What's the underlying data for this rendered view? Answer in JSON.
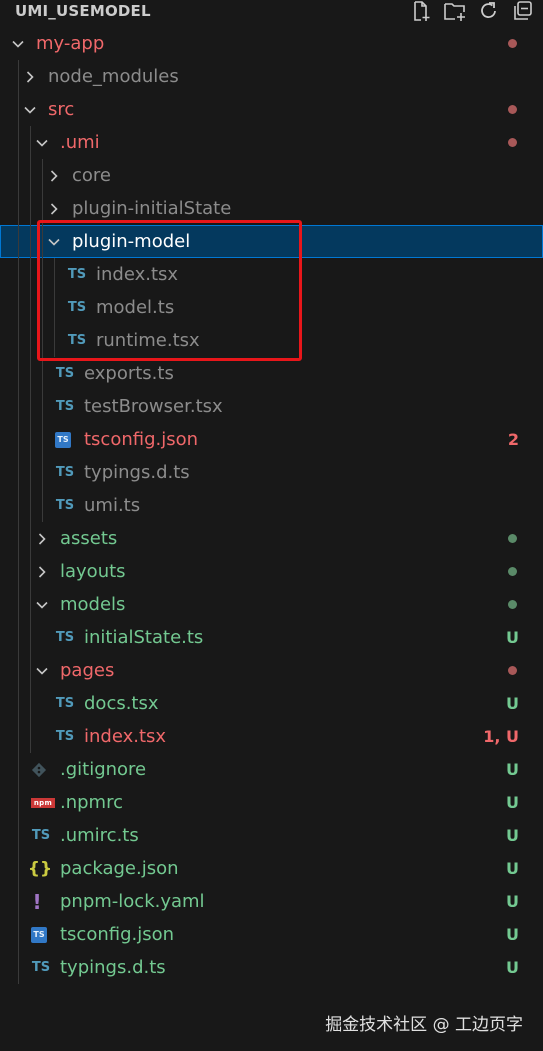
{
  "explorer": {
    "title": "UMI_USEMODEL",
    "actions": [
      {
        "name": "new-file-icon"
      },
      {
        "name": "new-folder-icon"
      },
      {
        "name": "refresh-icon"
      },
      {
        "name": "collapse-all-icon"
      }
    ]
  },
  "tree": [
    {
      "label": "my-app",
      "kind": "folder",
      "expanded": true,
      "depth": 0,
      "color": "red",
      "badge": "dot-red"
    },
    {
      "label": "node_modules",
      "kind": "folder",
      "expanded": false,
      "depth": 1,
      "color": "ignored"
    },
    {
      "label": "src",
      "kind": "folder",
      "expanded": true,
      "depth": 1,
      "color": "red",
      "badge": "dot-red"
    },
    {
      "label": ".umi",
      "kind": "folder",
      "expanded": true,
      "depth": 2,
      "color": "red",
      "badge": "dot-red"
    },
    {
      "label": "core",
      "kind": "folder",
      "expanded": false,
      "depth": 3,
      "color": "ignored"
    },
    {
      "label": "plugin-initialState",
      "kind": "folder",
      "expanded": false,
      "depth": 3,
      "color": "ignored"
    },
    {
      "label": "plugin-model",
      "kind": "folder",
      "expanded": true,
      "depth": 3,
      "color": "white",
      "selected": true
    },
    {
      "label": "index.tsx",
      "kind": "ts",
      "depth": 4,
      "color": "ignored"
    },
    {
      "label": "model.ts",
      "kind": "ts",
      "depth": 4,
      "color": "ignored"
    },
    {
      "label": "runtime.tsx",
      "kind": "ts",
      "depth": 4,
      "color": "ignored"
    },
    {
      "label": "exports.ts",
      "kind": "ts",
      "depth": 3,
      "color": "ignored"
    },
    {
      "label": "testBrowser.tsx",
      "kind": "ts",
      "depth": 3,
      "color": "ignored"
    },
    {
      "label": "tsconfig.json",
      "kind": "tsjson",
      "depth": 3,
      "color": "red",
      "badge": "2"
    },
    {
      "label": "typings.d.ts",
      "kind": "ts",
      "depth": 3,
      "color": "ignored"
    },
    {
      "label": "umi.ts",
      "kind": "ts",
      "depth": 3,
      "color": "ignored"
    },
    {
      "label": "assets",
      "kind": "folder",
      "expanded": false,
      "depth": 2,
      "color": "green",
      "badge": "dot-green"
    },
    {
      "label": "layouts",
      "kind": "folder",
      "expanded": false,
      "depth": 2,
      "color": "green",
      "badge": "dot-green"
    },
    {
      "label": "models",
      "kind": "folder",
      "expanded": true,
      "depth": 2,
      "color": "green",
      "badge": "dot-green"
    },
    {
      "label": "initialState.ts",
      "kind": "ts",
      "depth": 3,
      "color": "green",
      "badge": "U"
    },
    {
      "label": "pages",
      "kind": "folder",
      "expanded": true,
      "depth": 2,
      "color": "red",
      "badge": "dot-red"
    },
    {
      "label": "docs.tsx",
      "kind": "ts",
      "depth": 3,
      "color": "green",
      "badge": "U"
    },
    {
      "label": "index.tsx",
      "kind": "ts",
      "depth": 3,
      "color": "red",
      "badge": "1, U"
    },
    {
      "label": ".gitignore",
      "kind": "git",
      "depth": 1,
      "color": "green",
      "badge": "U"
    },
    {
      "label": ".npmrc",
      "kind": "npm",
      "depth": 1,
      "color": "green",
      "badge": "U"
    },
    {
      "label": ".umirc.ts",
      "kind": "ts",
      "depth": 1,
      "color": "green",
      "badge": "U"
    },
    {
      "label": "package.json",
      "kind": "json",
      "depth": 1,
      "color": "green",
      "badge": "U"
    },
    {
      "label": "pnpm-lock.yaml",
      "kind": "yaml",
      "depth": 1,
      "color": "green",
      "badge": "U"
    },
    {
      "label": "tsconfig.json",
      "kind": "tsjson",
      "depth": 1,
      "color": "green",
      "badge": "U"
    },
    {
      "label": "typings.d.ts",
      "kind": "ts",
      "depth": 1,
      "color": "green",
      "badge": "U"
    }
  ],
  "icons": {
    "ts": "TS",
    "json": "{}",
    "yaml": "!",
    "npm": "npm",
    "tsjson": "TS"
  },
  "watermark": "掘金技术社区 @ 工边页字",
  "colors": {
    "background": "#181818",
    "selected": "#04395e",
    "highlight_box": "#e8161a",
    "modified": "#f0686a",
    "untracked": "#73c991",
    "ignored": "#8c8c8c"
  }
}
